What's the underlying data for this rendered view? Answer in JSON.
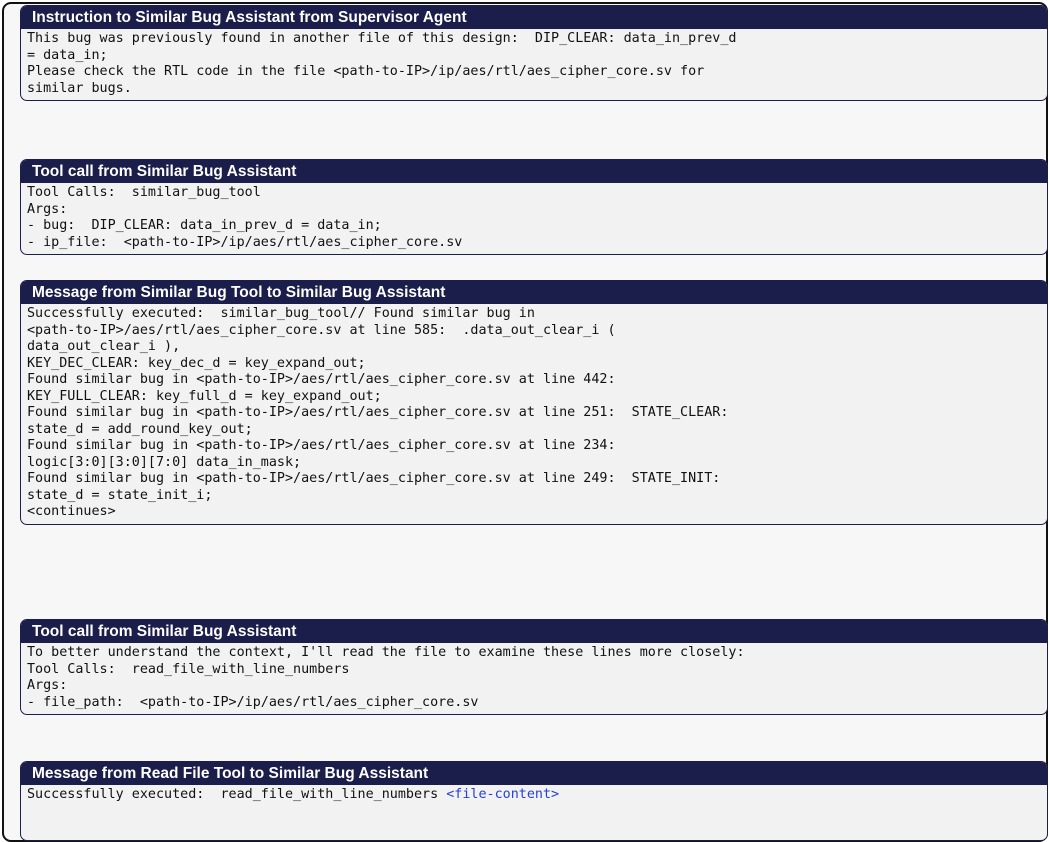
{
  "boxes": [
    {
      "title": "Instruction to Similar Bug Assistant from Supervisor Agent",
      "lines": [
        "This bug was previously found in another file of this design:  DIP_CLEAR: data_in_prev_d",
        "= data_in;",
        "Please check the RTL code in the file <path-to-IP>/ip/aes/rtl/aes_cipher_core.sv for",
        "similar bugs."
      ]
    },
    {
      "title": "Tool call from Similar Bug Assistant",
      "lines": [
        "Tool Calls:  similar_bug_tool",
        "Args:",
        "- bug:  DIP_CLEAR: data_in_prev_d = data_in;",
        "- ip_file:  <path-to-IP>/ip/aes/rtl/aes_cipher_core.sv"
      ]
    },
    {
      "title": "Message from Similar Bug Tool to Similar Bug Assistant",
      "lines": [
        "Successfully executed:  similar_bug_tool// Found similar bug in",
        "<path-to-IP>/aes/rtl/aes_cipher_core.sv at line 585:  .data_out_clear_i (",
        "data_out_clear_i ),",
        "KEY_DEC_CLEAR: key_dec_d = key_expand_out;",
        "Found similar bug in <path-to-IP>/aes/rtl/aes_cipher_core.sv at line 442:",
        "KEY_FULL_CLEAR: key_full_d = key_expand_out;",
        "Found similar bug in <path-to-IP>/aes/rtl/aes_cipher_core.sv at line 251:  STATE_CLEAR:",
        "state_d = add_round_key_out;",
        "Found similar bug in <path-to-IP>/aes/rtl/aes_cipher_core.sv at line 234:",
        "logic[3:0][3:0][7:0] data_in_mask;",
        "Found similar bug in <path-to-IP>/aes/rtl/aes_cipher_core.sv at line 249:  STATE_INIT:",
        "state_d = state_init_i;",
        "<continues>"
      ]
    },
    {
      "title": "Tool call from Similar Bug Assistant",
      "lines": [
        "To better understand the context, I'll read the file to examine these lines more closely:",
        "Tool Calls:  read_file_with_line_numbers",
        "Args:",
        "- file_path:  <path-to-IP>/ip/aes/rtl/aes_cipher_core.sv"
      ]
    },
    {
      "title": "Message from Read File Tool to Similar Bug Assistant",
      "lines": [
        "Successfully executed:  read_file_with_line_numbers "
      ],
      "link": "<file-content>"
    }
  ],
  "colors": {
    "header_bg": "#1b1d4a",
    "body_bg": "#f2f2f2",
    "link": "#2640d6"
  }
}
